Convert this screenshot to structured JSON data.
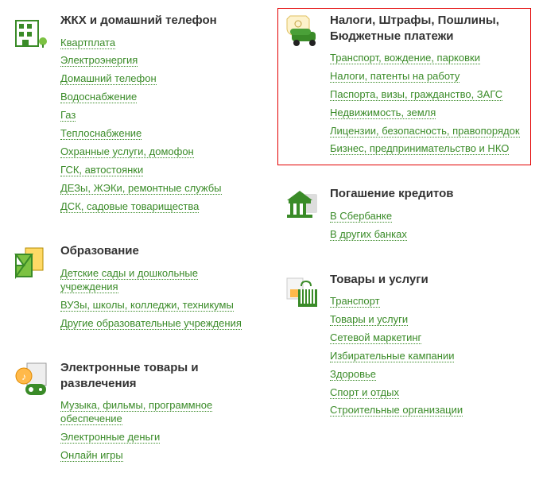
{
  "left": [
    {
      "title": "ЖКХ и домашний телефон",
      "icon": "house-icon",
      "links": [
        "Квартплата",
        "Электроэнергия",
        "Домашний телефон",
        "Водоснабжение",
        "Газ",
        "Теплоснабжение",
        "Охранные услуги, домофон",
        "ГСК, автостоянки",
        "ДЕЗы, ЖЭКи, ремонтные службы",
        "ДСК, садовые товарищества"
      ]
    },
    {
      "title": "Образование",
      "icon": "education-icon",
      "links": [
        "Детские сады и дошкольные учреждения",
        "ВУЗы, школы, колледжи, техникумы",
        "Другие образовательные учреждения"
      ]
    },
    {
      "title": "Электронные товары и развлечения",
      "icon": "entertainment-icon",
      "links": [
        "Музыка, фильмы, программное обеспечение",
        "Электронные деньги",
        "Онлайн игры"
      ]
    }
  ],
  "right": [
    {
      "title": "Налоги, Штрафы, Пошлины, Бюджетные платежи",
      "icon": "tax-icon",
      "highlighted": true,
      "links": [
        "Транспорт, вождение, парковки",
        "Налоги, патенты на работу",
        "Паспорта, визы, гражданство, ЗАГС",
        "Недвижимость, земля",
        "Лицензии, безопасность, правопорядок",
        "Бизнес, предпринимательство и НКО"
      ]
    },
    {
      "title": "Погашение кредитов",
      "icon": "bank-icon",
      "links": [
        "В Сбербанке",
        "В других банках"
      ]
    },
    {
      "title": "Товары и услуги",
      "icon": "goods-icon",
      "links": [
        "Транспорт",
        "Товары и услуги",
        "Сетевой маркетинг",
        "Избирательные кампании",
        "Здоровье",
        "Спорт и отдых",
        "Строительные организации"
      ]
    }
  ]
}
